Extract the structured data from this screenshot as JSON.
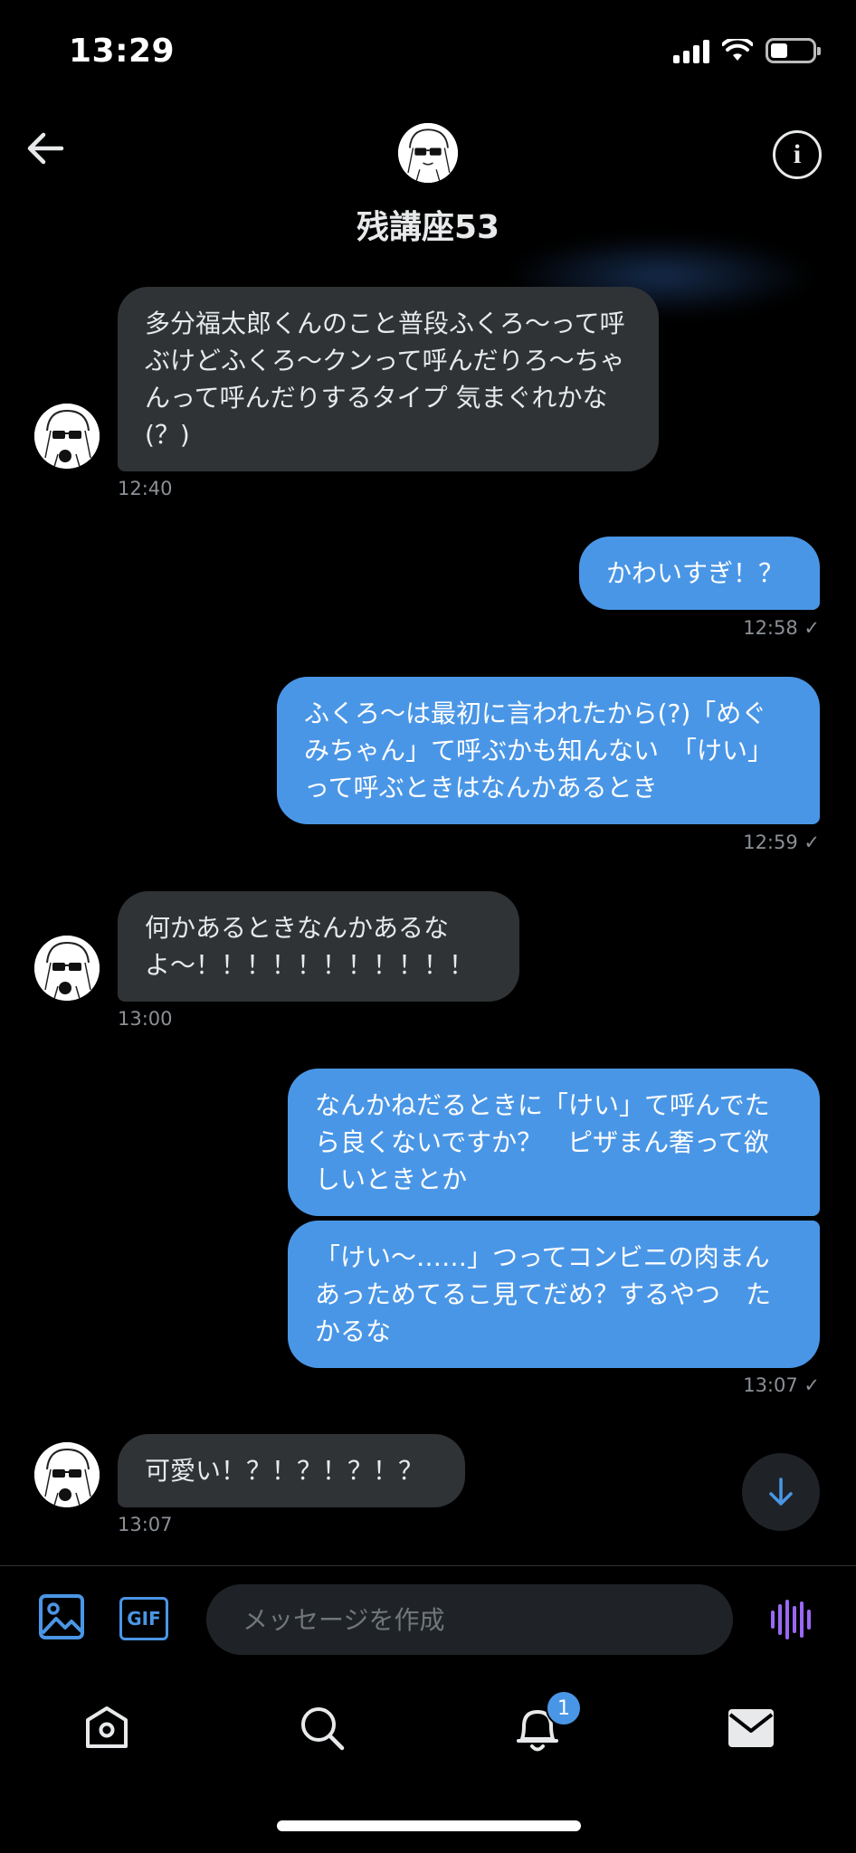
{
  "status_bar": {
    "time": "13:29"
  },
  "header": {
    "name": "残講座53"
  },
  "messages": [
    {
      "direction": "in",
      "text": "多分福太郎くんのこと普段ふくろ〜って呼ぶけどふくろ〜クンって呼んだりろ〜ちゃんって呼んだりするタイプ 気まぐれかな(？)",
      "time": "12:40"
    },
    {
      "direction": "out",
      "text": "かわいすぎ！？",
      "time": "12:58 ✓"
    },
    {
      "direction": "out",
      "text": "ふくろ〜は最初に言われたから(?)「めぐみちゃん」て呼ぶかも知んない　「けい」って呼ぶときはなんかあるとき",
      "time": "12:59 ✓"
    },
    {
      "direction": "in",
      "text": "何かあるときなんかあるなよ〜！！！！！！！！！！！",
      "time": "13:00"
    },
    {
      "direction": "out",
      "text": "なんかねだるときに「けい」て呼んでたら良くないですか？　ピザまん奢って欲しいときとか",
      "time": ""
    },
    {
      "direction": "out",
      "text": "「けい〜……」つってコンビニの肉まんあっためてるこ見てだめ？するやつ　たかるな",
      "time": "13:07 ✓"
    },
    {
      "direction": "in",
      "text": "可愛い！？！？！？！？",
      "time": "13:07"
    }
  ],
  "composer": {
    "gif_label": "GIF",
    "placeholder": "メッセージを作成"
  },
  "tab_bar": {
    "notification_count": "1"
  },
  "colors": {
    "accent": "#4a96e6",
    "incoming_bubble": "#2f3336",
    "voice": "#9b68f5"
  }
}
